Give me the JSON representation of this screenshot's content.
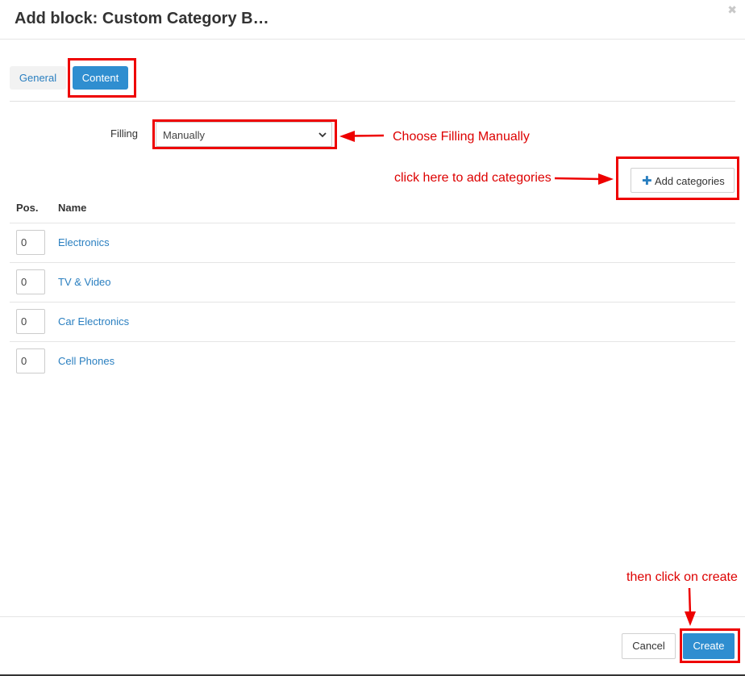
{
  "dialog": {
    "title": "Add block: Custom Category B…",
    "close_icon": "✖"
  },
  "tabs": [
    {
      "label": "General",
      "active": false
    },
    {
      "label": "Content",
      "active": true
    }
  ],
  "filling": {
    "label": "Filling",
    "selected": "Manually"
  },
  "add_categories": {
    "icon": "plus-icon",
    "icon_glyph": "✚",
    "label": "Add categories"
  },
  "table": {
    "headers": [
      "Pos.",
      "Name"
    ],
    "rows": [
      {
        "pos": "0",
        "name": "Electronics"
      },
      {
        "pos": "0",
        "name": "TV & Video"
      },
      {
        "pos": "0",
        "name": "Car Electronics"
      },
      {
        "pos": "0",
        "name": "Cell Phones"
      }
    ]
  },
  "footer": {
    "cancel_label": "Cancel",
    "create_label": "Create"
  },
  "annotations": {
    "filling_note": "Choose Filling Manually",
    "add_note": "click here to add categories",
    "create_note": "then click on create",
    "color": "#ee0000"
  },
  "colors": {
    "primary": "#2f8ed0",
    "link": "#2a7fc0"
  }
}
